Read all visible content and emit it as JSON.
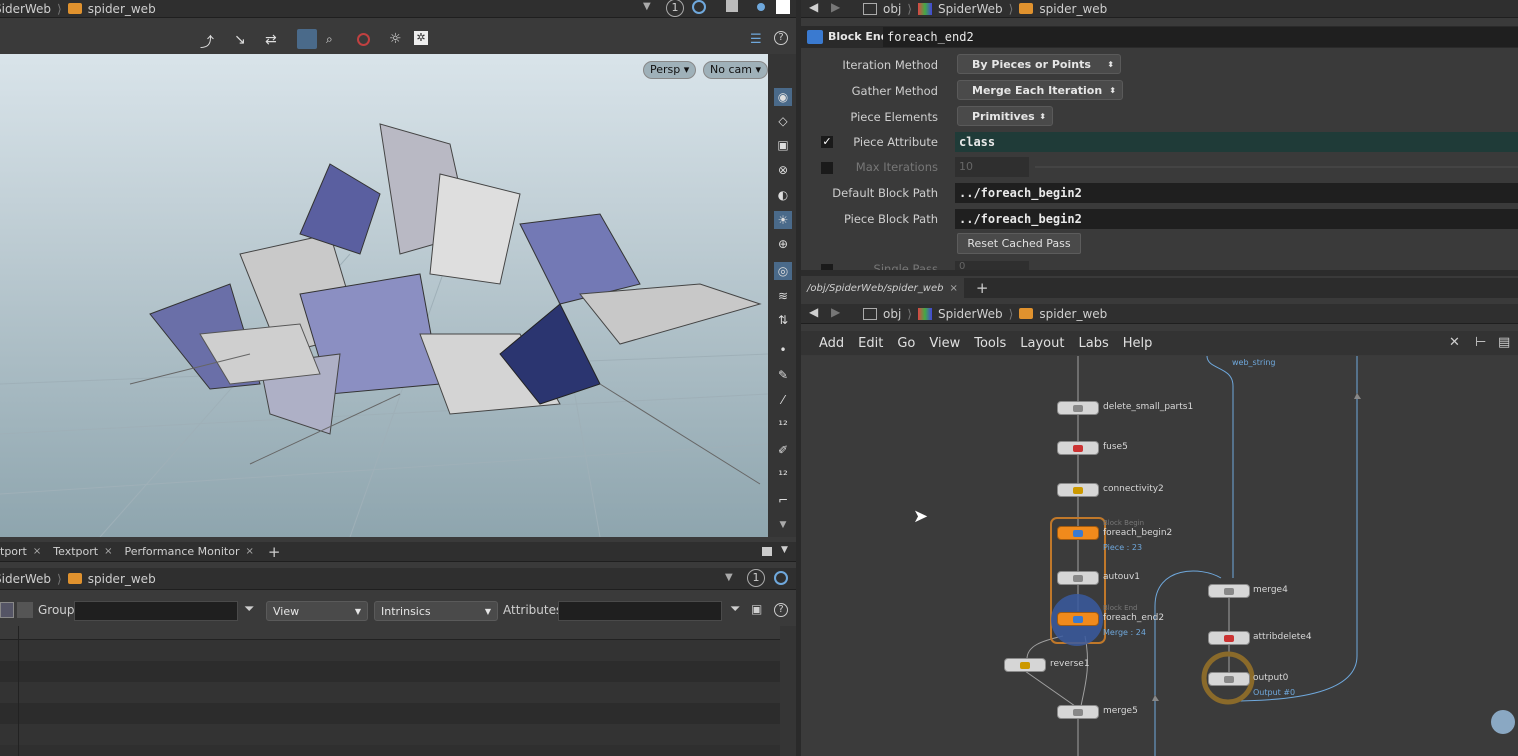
{
  "left_top": {
    "crumb1": "SiderWeb",
    "crumb2": "spider_web",
    "counter": "1"
  },
  "viewport": {
    "persp": "Persp",
    "nocam": "No cam"
  },
  "bottom_tabs": [
    "tport",
    "Textport",
    "Performance Monitor"
  ],
  "bottom_crumb": {
    "crumb1": "SiderWeb",
    "crumb2": "spider_web",
    "counter": "1"
  },
  "spreadsheet": {
    "group_label": "Group:",
    "view": "View",
    "intrinsics": "Intrinsics",
    "attributes_label": "Attributes:"
  },
  "right_top": {
    "obj": "obj",
    "net": "SpiderWeb",
    "node": "spider_web"
  },
  "params": {
    "node_type": "Block End",
    "node_name": "foreach_end2",
    "iteration_method_label": "Iteration Method",
    "iteration_method": "By Pieces or Points",
    "gather_method_label": "Gather Method",
    "gather_method": "Merge Each Iteration",
    "piece_elements_label": "Piece Elements",
    "piece_elements": "Primitives",
    "piece_attribute_label": "Piece Attribute",
    "piece_attribute": "class",
    "max_iterations_label": "Max Iterations",
    "max_iterations": "10",
    "default_block_path_label": "Default Block Path",
    "default_block_path": "../foreach_begin2",
    "piece_block_path_label": "Piece Block Path",
    "piece_block_path": "../foreach_begin2",
    "reset_button": "Reset Cached Pass",
    "single_pass_label": "Single Pass",
    "single_pass": "0"
  },
  "net_tab": {
    "path": "/obj/SpiderWeb/spider_web",
    "obj": "obj",
    "net": "SpiderWeb",
    "node": "spider_web"
  },
  "net_menu": [
    "Add",
    "Edit",
    "Go",
    "View",
    "Tools",
    "Layout",
    "Labs",
    "Help"
  ],
  "nodes": {
    "delete_small_parts1": "delete_small_parts1",
    "fuse5": "fuse5",
    "connectivity2": "connectivity2",
    "foreach_begin2_type": "Block Begin",
    "foreach_begin2": "foreach_begin2",
    "foreach_begin2_sub": "Piece : 23",
    "autouv1": "autouv1",
    "foreach_end2_type": "Block End",
    "foreach_end2": "foreach_end2",
    "foreach_end2_sub": "Merge : 24",
    "reverse1": "reverse1",
    "merge5": "merge5",
    "merge4": "merge4",
    "attribdelete4": "attribdelete4",
    "output0": "output0",
    "output0_sub": "Output #0",
    "web_string": "web_string"
  },
  "colors": {
    "accent": "#f08a1c",
    "teal_field": "#1f3b38",
    "node_bg": "#d6d6d6",
    "wire": "#6fa8dc"
  }
}
